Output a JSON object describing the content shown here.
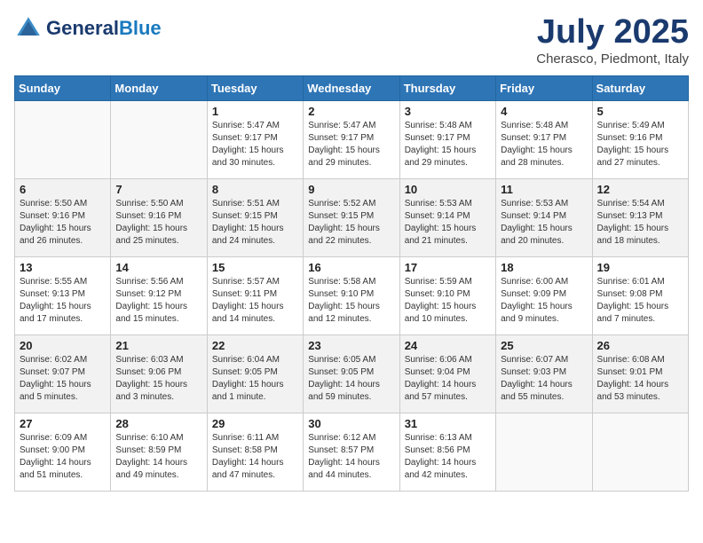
{
  "header": {
    "logo_line1": "General",
    "logo_line2": "Blue",
    "month": "July 2025",
    "location": "Cherasco, Piedmont, Italy"
  },
  "weekdays": [
    "Sunday",
    "Monday",
    "Tuesday",
    "Wednesday",
    "Thursday",
    "Friday",
    "Saturday"
  ],
  "weeks": [
    [
      {
        "day": "",
        "info": ""
      },
      {
        "day": "",
        "info": ""
      },
      {
        "day": "1",
        "info": "Sunrise: 5:47 AM\nSunset: 9:17 PM\nDaylight: 15 hours\nand 30 minutes."
      },
      {
        "day": "2",
        "info": "Sunrise: 5:47 AM\nSunset: 9:17 PM\nDaylight: 15 hours\nand 29 minutes."
      },
      {
        "day": "3",
        "info": "Sunrise: 5:48 AM\nSunset: 9:17 PM\nDaylight: 15 hours\nand 29 minutes."
      },
      {
        "day": "4",
        "info": "Sunrise: 5:48 AM\nSunset: 9:17 PM\nDaylight: 15 hours\nand 28 minutes."
      },
      {
        "day": "5",
        "info": "Sunrise: 5:49 AM\nSunset: 9:16 PM\nDaylight: 15 hours\nand 27 minutes."
      }
    ],
    [
      {
        "day": "6",
        "info": "Sunrise: 5:50 AM\nSunset: 9:16 PM\nDaylight: 15 hours\nand 26 minutes."
      },
      {
        "day": "7",
        "info": "Sunrise: 5:50 AM\nSunset: 9:16 PM\nDaylight: 15 hours\nand 25 minutes."
      },
      {
        "day": "8",
        "info": "Sunrise: 5:51 AM\nSunset: 9:15 PM\nDaylight: 15 hours\nand 24 minutes."
      },
      {
        "day": "9",
        "info": "Sunrise: 5:52 AM\nSunset: 9:15 PM\nDaylight: 15 hours\nand 22 minutes."
      },
      {
        "day": "10",
        "info": "Sunrise: 5:53 AM\nSunset: 9:14 PM\nDaylight: 15 hours\nand 21 minutes."
      },
      {
        "day": "11",
        "info": "Sunrise: 5:53 AM\nSunset: 9:14 PM\nDaylight: 15 hours\nand 20 minutes."
      },
      {
        "day": "12",
        "info": "Sunrise: 5:54 AM\nSunset: 9:13 PM\nDaylight: 15 hours\nand 18 minutes."
      }
    ],
    [
      {
        "day": "13",
        "info": "Sunrise: 5:55 AM\nSunset: 9:13 PM\nDaylight: 15 hours\nand 17 minutes."
      },
      {
        "day": "14",
        "info": "Sunrise: 5:56 AM\nSunset: 9:12 PM\nDaylight: 15 hours\nand 15 minutes."
      },
      {
        "day": "15",
        "info": "Sunrise: 5:57 AM\nSunset: 9:11 PM\nDaylight: 15 hours\nand 14 minutes."
      },
      {
        "day": "16",
        "info": "Sunrise: 5:58 AM\nSunset: 9:10 PM\nDaylight: 15 hours\nand 12 minutes."
      },
      {
        "day": "17",
        "info": "Sunrise: 5:59 AM\nSunset: 9:10 PM\nDaylight: 15 hours\nand 10 minutes."
      },
      {
        "day": "18",
        "info": "Sunrise: 6:00 AM\nSunset: 9:09 PM\nDaylight: 15 hours\nand 9 minutes."
      },
      {
        "day": "19",
        "info": "Sunrise: 6:01 AM\nSunset: 9:08 PM\nDaylight: 15 hours\nand 7 minutes."
      }
    ],
    [
      {
        "day": "20",
        "info": "Sunrise: 6:02 AM\nSunset: 9:07 PM\nDaylight: 15 hours\nand 5 minutes."
      },
      {
        "day": "21",
        "info": "Sunrise: 6:03 AM\nSunset: 9:06 PM\nDaylight: 15 hours\nand 3 minutes."
      },
      {
        "day": "22",
        "info": "Sunrise: 6:04 AM\nSunset: 9:05 PM\nDaylight: 15 hours\nand 1 minute."
      },
      {
        "day": "23",
        "info": "Sunrise: 6:05 AM\nSunset: 9:05 PM\nDaylight: 14 hours\nand 59 minutes."
      },
      {
        "day": "24",
        "info": "Sunrise: 6:06 AM\nSunset: 9:04 PM\nDaylight: 14 hours\nand 57 minutes."
      },
      {
        "day": "25",
        "info": "Sunrise: 6:07 AM\nSunset: 9:03 PM\nDaylight: 14 hours\nand 55 minutes."
      },
      {
        "day": "26",
        "info": "Sunrise: 6:08 AM\nSunset: 9:01 PM\nDaylight: 14 hours\nand 53 minutes."
      }
    ],
    [
      {
        "day": "27",
        "info": "Sunrise: 6:09 AM\nSunset: 9:00 PM\nDaylight: 14 hours\nand 51 minutes."
      },
      {
        "day": "28",
        "info": "Sunrise: 6:10 AM\nSunset: 8:59 PM\nDaylight: 14 hours\nand 49 minutes."
      },
      {
        "day": "29",
        "info": "Sunrise: 6:11 AM\nSunset: 8:58 PM\nDaylight: 14 hours\nand 47 minutes."
      },
      {
        "day": "30",
        "info": "Sunrise: 6:12 AM\nSunset: 8:57 PM\nDaylight: 14 hours\nand 44 minutes."
      },
      {
        "day": "31",
        "info": "Sunrise: 6:13 AM\nSunset: 8:56 PM\nDaylight: 14 hours\nand 42 minutes."
      },
      {
        "day": "",
        "info": ""
      },
      {
        "day": "",
        "info": ""
      }
    ]
  ]
}
